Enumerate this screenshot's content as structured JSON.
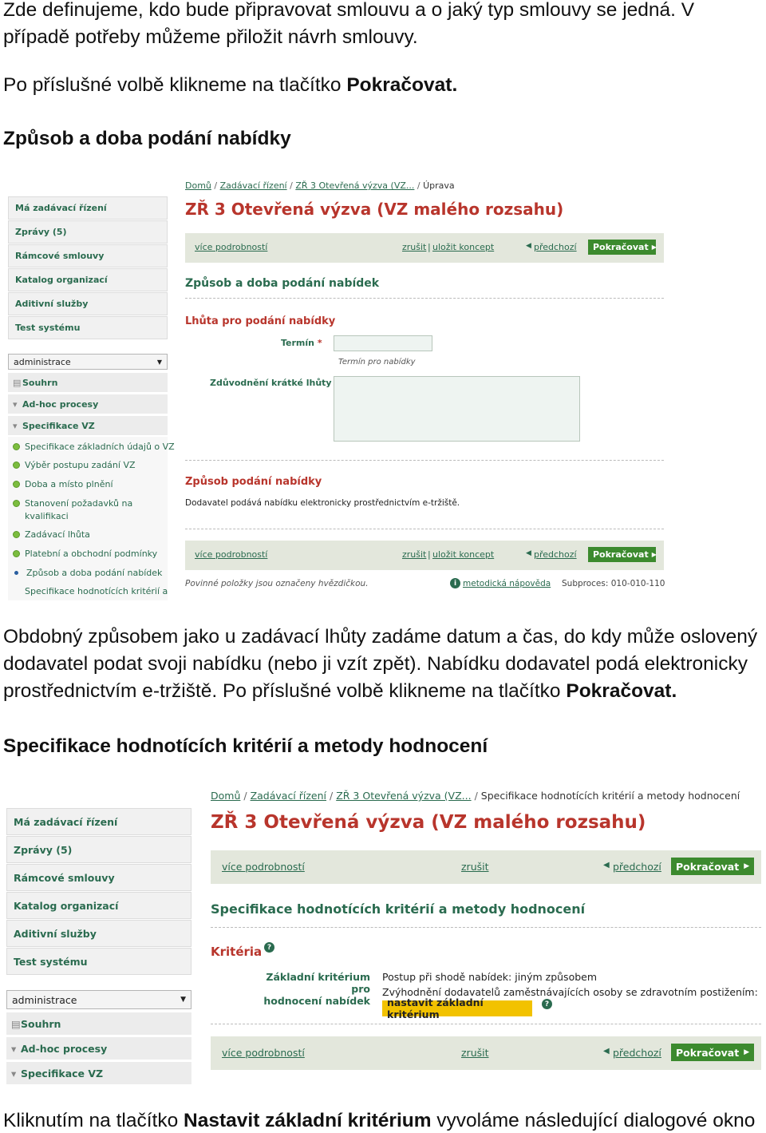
{
  "paragraphs": {
    "p1": "Zde definujeme, kdo bude připravovat smlouvu a o jaký typ smlouvy se jedná. V případě potřeby můžeme přiložit návrh smlouvy.",
    "p2_pre": "Po příslušné volbě klikneme na tlačítko ",
    "p2_bold": "Pokračovat.",
    "p3_pre": "Obdobný způsobem jako u zadávací lhůty zadáme datum a čas, do kdy může oslovený dodavatel podat svoji nabídku (nebo ji vzít zpět). Nabídku dodavatel podá elektronicky prostřednictvím e-tržiště. Po příslušné volbě klikneme na tlačítko ",
    "p3_bold": "Pokračovat.",
    "p4_pre": "Kliknutím na tlačítko ",
    "p4_bold": "Nastavit základní kritérium",
    "p4_post": " vyvoláme následující dialogové okno"
  },
  "headings": {
    "h1": "Způsob a doba podání nabídky",
    "h2": "Specifikace hodnotících kritérií a metody hodnocení"
  },
  "shot1": {
    "sidebar": [
      "Má zadávací řízení",
      "Zprávy (5)",
      "Rámcové smlouvy",
      "Katalog organizací",
      "Aditivní služby",
      "Test systému"
    ],
    "select_value": "administrace",
    "select_arrow": "▼",
    "groups": [
      "Souhrn",
      "Ad-hoc procesy",
      "Specifikace VZ"
    ],
    "group_arrows": [
      "▤",
      "▾",
      "▾"
    ],
    "steps": [
      "Specifikace základních údajů o VZ",
      "Výběr postupu zadání VZ",
      "Doba a místo plnění",
      "Stanovení požadavků na",
      "kvalifikaci",
      "Zadávací lhůta",
      "Platební a obchodní podmínky",
      "Způsob a doba podání nabídek",
      "Specifikace hodnotících kritérií a"
    ],
    "breadcrumb": [
      "Domů",
      "Zadávací řízení",
      "ZŘ 3 Otevřená výzva (VZ...",
      "Úprava"
    ],
    "breadcrumb_sep": "/",
    "title": "ZŘ 3 Otevřená výzva (VZ malého rozsahu)",
    "bar": {
      "more": "více podrobností",
      "cancel": "zrušit",
      "divider": "|",
      "save": "uložit koncept",
      "prev_arrow": "◀",
      "prev": "předchozí",
      "next": "Pokračovat",
      "next_arrow": "▶"
    },
    "section": "Způsob a doba podání nabídek",
    "sub1": "Lhůta pro podání nabídky",
    "term_label": "Termín",
    "required_mark": "*",
    "term_hint": "Termín pro nabídky",
    "reason_label": "Zdůvodnění krátké lhůty",
    "sub2": "Způsob podání nabídky",
    "sub2_text": "Dodavatel podává nabídku elektronicky prostřednictvím e-tržiště.",
    "footer_note": "Povinné položky jsou označeny hvězdičkou.",
    "help_icon": "i",
    "help_link": "metodická nápověda",
    "subprocess": "Subproces: 010-010-110"
  },
  "shot2": {
    "sidebar": [
      "Má zadávací řízení",
      "Zprávy (5)",
      "Rámcové smlouvy",
      "Katalog organizací",
      "Aditivní služby",
      "Test systému"
    ],
    "select_value": "administrace",
    "select_arrow": "▼",
    "groups": [
      "Souhrn",
      "Ad-hoc procesy",
      "Specifikace VZ"
    ],
    "group_arrows": [
      "▤",
      "▾",
      "▾"
    ],
    "breadcrumb": [
      "Domů",
      "Zadávací řízení",
      "ZŘ 3 Otevřená výzva (VZ...",
      "Specifikace hodnotících kritérií a metody hodnocení"
    ],
    "breadcrumb_sep": "/",
    "title": "ZŘ 3 Otevřená výzva (VZ malého rozsahu)",
    "bar": {
      "more": "více podrobností",
      "cancel": "zrušit",
      "prev_arrow": "◀",
      "prev": "předchozí",
      "next": "Pokračovat",
      "next_arrow": "▶"
    },
    "section": "Specifikace hodnotících kritérií a metody hodnocení",
    "sub1": "Kritéria",
    "question_mark": "?",
    "crit_label1": "Základní kritérium pro",
    "crit_label2": "hodnocení nabídek",
    "crit_text1": "Postup při shodě nabídek: jiným způsobem",
    "crit_text2": "Zvýhodnění dodavatelů zaměstnávajících osoby se zdravotním postižením: Ne",
    "set_button": "nastavit základní kritérium"
  }
}
